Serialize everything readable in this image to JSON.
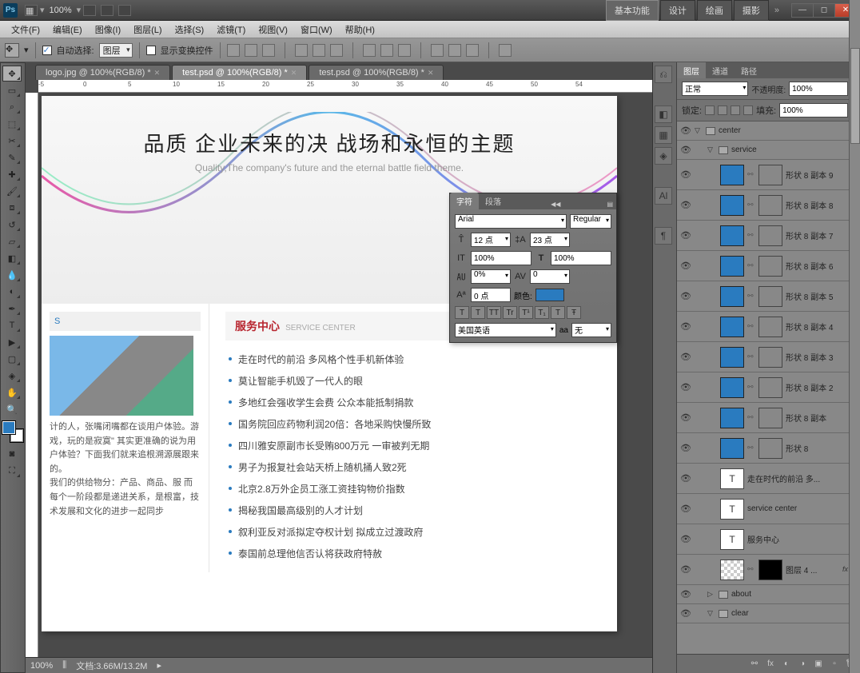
{
  "titlebar": {
    "zoom": "100%",
    "workspaces": [
      "基本功能",
      "设计",
      "绘画",
      "摄影"
    ],
    "active_ws": 0
  },
  "menus": [
    "文件(F)",
    "编辑(E)",
    "图像(I)",
    "图层(L)",
    "选择(S)",
    "滤镜(T)",
    "视图(V)",
    "窗口(W)",
    "帮助(H)"
  ],
  "options": {
    "auto_select": "自动选择:",
    "target": "图层",
    "transform": "显示变换控件"
  },
  "tabs": [
    {
      "label": "logo.jpg @ 100%(RGB/8) *"
    },
    {
      "label": "test.psd @ 100%(RGB/8) *"
    },
    {
      "label": "test.psd @ 100%(RGB/8) *"
    }
  ],
  "active_tab": 1,
  "ruler_marks": [
    -5,
    0,
    5,
    10,
    15,
    20,
    25,
    30,
    35,
    40,
    45,
    50,
    54
  ],
  "doc": {
    "title_cn": "品质 企业未来的决 战场和永恒的主题",
    "title_en": "Quality,The company's future and the eternal battle field theme.",
    "left_label": "S",
    "section_cn": "服务中心",
    "section_en": "SERVICE CENTER",
    "left_text": "计的人，张嘴闭嘴都在谈用户体验。游戏，玩的是寂寞\" 其实更准确的说为用户体验？下面我们就来追根溯源展跟来的。\n我们的供给物分：产品、商品、服 而每个一阶段都是递进关系，是根富，技术发展和文化的进步一起同步",
    "list": [
      "走在时代的前沿 多风格个性手机新体验",
      "莫让智能手机毁了一代人的眼",
      "多地红会强收学生会费 公众本能抵制捐款",
      "国务院回应药物利润20倍：各地采购快慢所致",
      "四川雅安原副市长受贿800万元 一审被判无期",
      "男子为报复社会站天桥上随机捅人致2死",
      "北京2.8万外企员工涨工资挂钩物价指数",
      "揭秘我国最高级别的人才计划",
      "叙利亚反对派拟定夺权计划 拟成立过渡政府",
      "泰国前总理他信否认将获政府特赦"
    ]
  },
  "char_panel": {
    "tabs": [
      "字符",
      "段落"
    ],
    "font": "Arial",
    "style": "Regular",
    "size": "12 点",
    "leading": "23 点",
    "vscale": "100%",
    "hscale": "100%",
    "tracking_a": "0%",
    "tracking_b": "0",
    "baseline": "0 点",
    "color_label": "颜色:",
    "lang": "美国英语",
    "aa_label": "aa",
    "aa": "无",
    "styles": [
      "T",
      "T",
      "TT",
      "Tr",
      "T¹",
      "T₁",
      "T",
      "Ŧ"
    ]
  },
  "status": {
    "zoom": "100%",
    "doc_info": "文档:3.66M/13.2M"
  },
  "layers_panel": {
    "tabs": [
      "图层",
      "通道",
      "路径"
    ],
    "blend": "正常",
    "opacity_label": "不透明度:",
    "opacity": "100%",
    "lock_label": "锁定:",
    "fill_label": "填充:",
    "fill": "100%",
    "layers": [
      {
        "type": "group",
        "name": "center",
        "indent": 0,
        "open": true
      },
      {
        "type": "group",
        "name": "service",
        "indent": 1,
        "open": true
      },
      {
        "type": "shape",
        "name": "形状 8 副本 9",
        "indent": 2
      },
      {
        "type": "shape",
        "name": "形状 8 副本 8",
        "indent": 2
      },
      {
        "type": "shape",
        "name": "形状 8 副本 7",
        "indent": 2
      },
      {
        "type": "shape",
        "name": "形状 8 副本 6",
        "indent": 2
      },
      {
        "type": "shape",
        "name": "形状 8 副本 5",
        "indent": 2
      },
      {
        "type": "shape",
        "name": "形状 8 副本 4",
        "indent": 2
      },
      {
        "type": "shape",
        "name": "形状 8 副本 3",
        "indent": 2
      },
      {
        "type": "shape",
        "name": "形状 8 副本 2",
        "indent": 2
      },
      {
        "type": "shape",
        "name": "形状 8 副本",
        "indent": 2
      },
      {
        "type": "shape",
        "name": "形状 8",
        "indent": 2
      },
      {
        "type": "text",
        "name": "走在时代的前沿 多...",
        "indent": 2
      },
      {
        "type": "text",
        "name": "service center",
        "indent": 2
      },
      {
        "type": "text",
        "name": "服务中心",
        "indent": 2
      },
      {
        "type": "fx",
        "name": "图层 4 ...",
        "indent": 2,
        "fx": true
      },
      {
        "type": "group",
        "name": "about",
        "indent": 1,
        "open": false
      },
      {
        "type": "group",
        "name": "clear",
        "indent": 1,
        "open": true
      }
    ]
  }
}
